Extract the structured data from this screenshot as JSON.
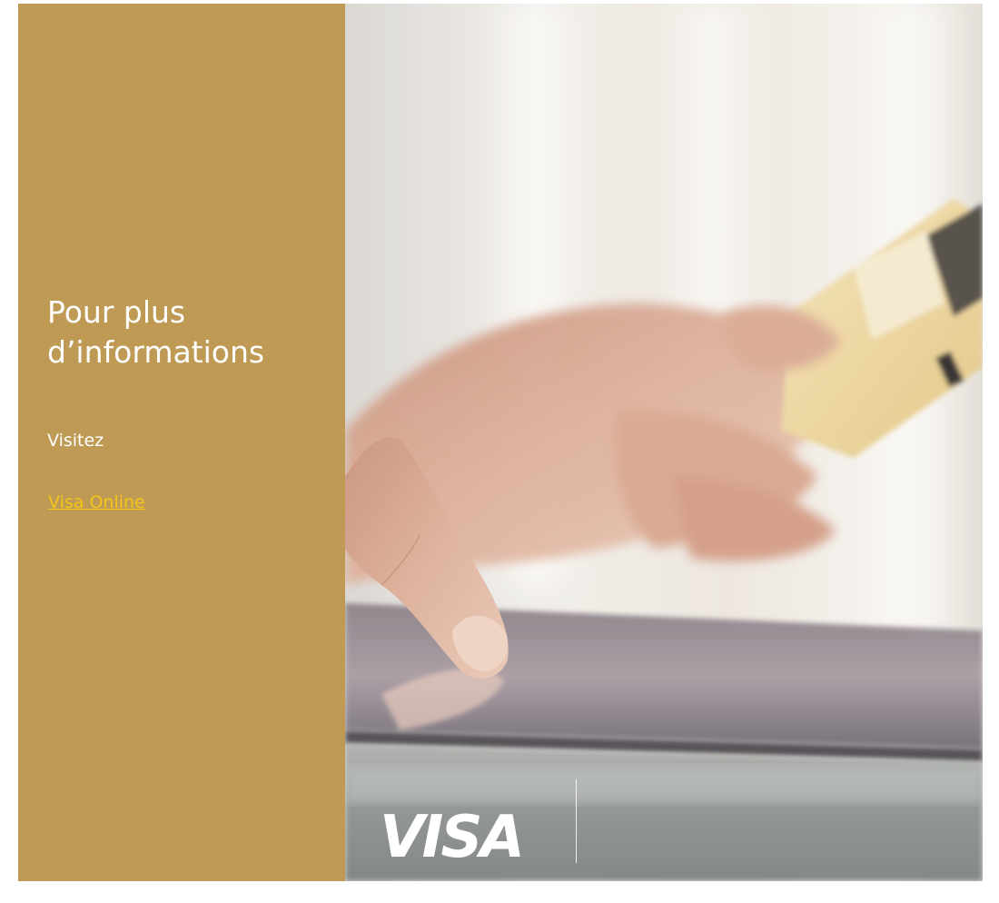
{
  "panel": {
    "heading_line1": "Pour plus",
    "heading_line2": "d’informations",
    "visit_label": "Visitez",
    "link_label": "Visa Online",
    "background_color": "#be9a55",
    "text_color": "#ffffff",
    "link_color": "#f5c518"
  },
  "photo": {
    "description_icon": "hand-card-tablet-photo",
    "logo_text": "VISA"
  }
}
